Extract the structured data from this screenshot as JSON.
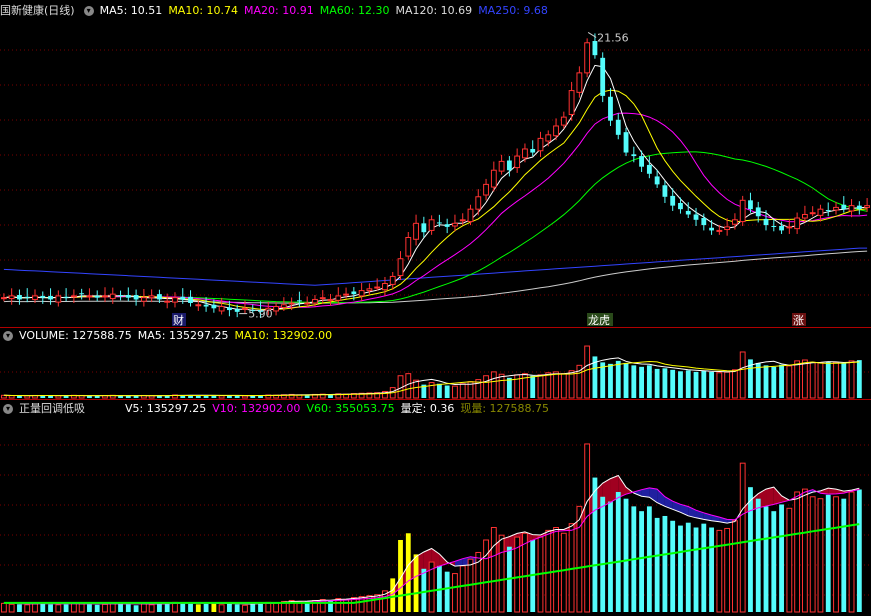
{
  "header": {
    "stock_title": "国新健康(日线)",
    "ma": [
      {
        "label": "MA5: 10.51",
        "color": "#ffffff"
      },
      {
        "label": "MA10: 10.74",
        "color": "#ffff00"
      },
      {
        "label": "MA20: 10.91",
        "color": "#ff00ff"
      },
      {
        "label": "MA60: 12.30",
        "color": "#00ff00"
      },
      {
        "label": "MA120: 10.69",
        "color": "#dddddd"
      },
      {
        "label": "MA250: 9.68",
        "color": "#3344ff"
      }
    ]
  },
  "volume_header": {
    "items": [
      {
        "label": "VOLUME: 127588.75",
        "color": "#ffffff"
      },
      {
        "label": "MA5: 135297.25",
        "color": "#ffffff"
      },
      {
        "label": "MA10: 132902.00",
        "color": "#ffff00"
      }
    ]
  },
  "indicator_header": {
    "name": "正量回调低吸",
    "items": [
      {
        "label": "V5: 135297.25",
        "color": "#ffffff"
      },
      {
        "label": "V10: 132902.00",
        "color": "#ff00ff"
      },
      {
        "label": "V60: 355053.75",
        "color": "#00ff00"
      },
      {
        "label": "量定: 0.36",
        "color": "#ffffff"
      },
      {
        "label": "现量: 127588.75",
        "color": "#888800"
      }
    ]
  },
  "markers": {
    "high_label": "21.56",
    "low_label": "5.90",
    "cai": "财",
    "longhu": "龙虎",
    "zhang": "涨"
  },
  "colors": {
    "up": "#ff3232",
    "down": "#54fcfc",
    "grid": "#7a0000",
    "yellow": "#ffff00"
  },
  "chart_data": {
    "type": "candlestick",
    "price_range": [
      5.2,
      22.6
    ],
    "high": 21.56,
    "low": 5.9,
    "closes": [
      6.8,
      6.9,
      6.7,
      6.8,
      6.9,
      6.8,
      6.7,
      6.9,
      6.8,
      6.9,
      7.0,
      6.9,
      6.8,
      6.9,
      7.0,
      6.9,
      6.8,
      6.7,
      6.8,
      6.9,
      6.7,
      6.6,
      6.8,
      6.7,
      6.5,
      6.4,
      6.3,
      6.2,
      6.3,
      6.1,
      6.0,
      6.2,
      6.1,
      6.0,
      6.2,
      6.3,
      6.4,
      6.5,
      6.6,
      6.5,
      6.7,
      6.8,
      6.7,
      6.9,
      7.0,
      7.0,
      7.2,
      7.3,
      7.4,
      7.6,
      8.0,
      9.0,
      10.2,
      11.0,
      10.5,
      11.2,
      11.0,
      10.8,
      11.0,
      11.2,
      11.8,
      12.5,
      13.2,
      14.0,
      14.5,
      14.0,
      14.8,
      15.2,
      15.0,
      15.8,
      16.0,
      16.5,
      17.0,
      18.5,
      19.5,
      21.2,
      20.5,
      18.2,
      16.8,
      16.0,
      15.0,
      14.8,
      14.2,
      13.8,
      13.2,
      12.5,
      12.0,
      11.8,
      11.5,
      11.2,
      10.9,
      10.6,
      10.6,
      10.8,
      11.2,
      12.3,
      11.8,
      11.4,
      10.9,
      10.8,
      10.6,
      10.8,
      11.3,
      11.5,
      11.6,
      11.8,
      11.7,
      11.9,
      11.8,
      12.0,
      11.8,
      12.0
    ],
    "volume": {
      "values": [
        9000,
        8000,
        8000,
        7500,
        8500,
        9500,
        8000,
        7500,
        8000,
        9000,
        8500,
        8000,
        7500,
        8000,
        9000,
        8500,
        8000,
        7000,
        8500,
        7500,
        9000,
        8500,
        10000,
        9000,
        9500,
        8000,
        8500,
        9000,
        7500,
        8500,
        8000,
        7000,
        8500,
        9500,
        10000,
        9500,
        11000,
        12000,
        10500,
        11000,
        12000,
        13000,
        12000,
        14000,
        13000,
        15000,
        16000,
        17000,
        18000,
        22000,
        35000,
        75000,
        82000,
        60000,
        45000,
        52000,
        48000,
        42000,
        40000,
        48000,
        55000,
        62000,
        75000,
        88000,
        80000,
        68000,
        78000,
        82000,
        75000,
        78000,
        85000,
        88000,
        82000,
        92000,
        110000,
        175000,
        140000,
        120000,
        115000,
        125000,
        118000,
        110000,
        105000,
        110000,
        98000,
        100000,
        95000,
        90000,
        93000,
        88000,
        92000,
        88000,
        85000,
        87000,
        95000,
        155000,
        130000,
        118000,
        110000,
        105000,
        112000,
        108000,
        125000,
        128000,
        120000,
        118000,
        122000,
        120000,
        118000,
        125000,
        127588
      ],
      "ma5": 135297.25,
      "ma10": 132902.0
    },
    "indicator": {
      "v5": 135297.25,
      "v10": 132902.0,
      "v60": 355053.75,
      "liangding": 0.36,
      "xianliang": 127588.75
    }
  }
}
